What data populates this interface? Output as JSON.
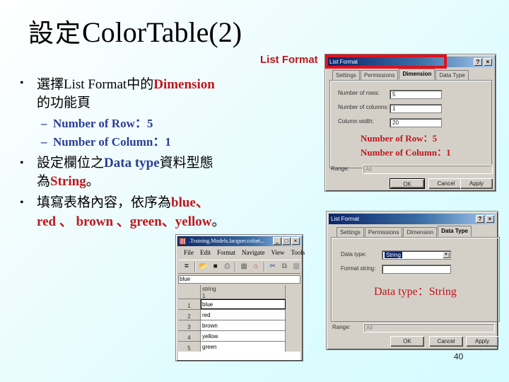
{
  "title": {
    "cjk": "設定",
    "latin": "Color.Table(2)"
  },
  "caption_list_format": "List Format",
  "bullets": [
    {
      "parts": [
        {
          "text": "選擇",
          "style": "cjk"
        },
        {
          "text": "List Format",
          "style": "plain"
        },
        {
          "text": "中的",
          "style": "cjk"
        },
        {
          "text": "Dimension",
          "style": "red"
        }
      ],
      "line2": "的功能頁",
      "subitems": [
        "Number of Row：5",
        "Number of Column：1"
      ]
    },
    {
      "parts": [
        {
          "text": "設定欄位之",
          "style": "cjk"
        },
        {
          "text": "Data type",
          "style": "blue"
        },
        {
          "text": "資料型態",
          "style": "cjk"
        }
      ],
      "line2_prefix": "為",
      "line2_red": "String",
      "line2_suffix": "。"
    },
    {
      "parts": [
        {
          "text": "填寫表格內容，依序為",
          "style": "cjk"
        },
        {
          "text": "blue、",
          "style": "red"
        }
      ],
      "line2_red": "red 、 brown 、green、yellow",
      "line2_suffix": "。"
    }
  ],
  "dialog_dimension": {
    "title": "List Format",
    "help_btn": "?",
    "close_btn": "×",
    "tabs": [
      "Settings",
      "Permissions",
      "Dimension",
      "Data Type"
    ],
    "active_tab": "Dimension",
    "fields": [
      {
        "label": "Number of rows:",
        "value": "5"
      },
      {
        "label": "Number of columns:",
        "value": "1"
      },
      {
        "label": "Column width:",
        "value": "20"
      }
    ],
    "overlay_lines": [
      "Number of Row：5",
      "Number of Column：1"
    ],
    "range_label": "Range:",
    "range_value": "All",
    "buttons": [
      "OK",
      "Cancel",
      "Apply"
    ]
  },
  "dialog_datatype": {
    "title": "List Format",
    "help_btn": "?",
    "close_btn": "×",
    "tabs": [
      "Settings",
      "Permissions",
      "Dimension",
      "Data Type"
    ],
    "active_tab": "Data Type",
    "fields": [
      {
        "label": "Data type:",
        "value": "String",
        "type": "select"
      },
      {
        "label": "Format string:",
        "value": "",
        "type": "text"
      }
    ],
    "overlay": "Data type：String",
    "range_label": "Range:",
    "range_value": "All",
    "buttons": [
      "OK",
      "Cancel",
      "Apply"
    ]
  },
  "color_table_window": {
    "title": ".Training.Models.lacquer.colort...",
    "window_buttons": [
      "_",
      "□",
      "×"
    ],
    "menu": [
      "File",
      "Edit",
      "Format",
      "Navigate",
      "View",
      "Tools"
    ],
    "toolbar_icons": [
      "equals-icon",
      "open-folder-icon",
      "save-icon",
      "print-icon",
      "find-icon",
      "home-icon",
      "cut-icon",
      "copy-icon",
      "paste-icon"
    ],
    "edit_line_value": "blue",
    "column_header": "string",
    "column_index": "1",
    "rows": [
      {
        "index": "1",
        "value": "blue"
      },
      {
        "index": "2",
        "value": "red"
      },
      {
        "index": "3",
        "value": "brown"
      },
      {
        "index": "4",
        "value": "yellow"
      },
      {
        "index": "5",
        "value": "green"
      }
    ]
  },
  "page_number": "40",
  "colors": {
    "accent_red": "#c0161c",
    "accent_blue": "#2b3c93",
    "highlight_box": "#e3101e",
    "dialog_gray": "#d4d0c8",
    "titlebar_dark": "#0a246a"
  }
}
